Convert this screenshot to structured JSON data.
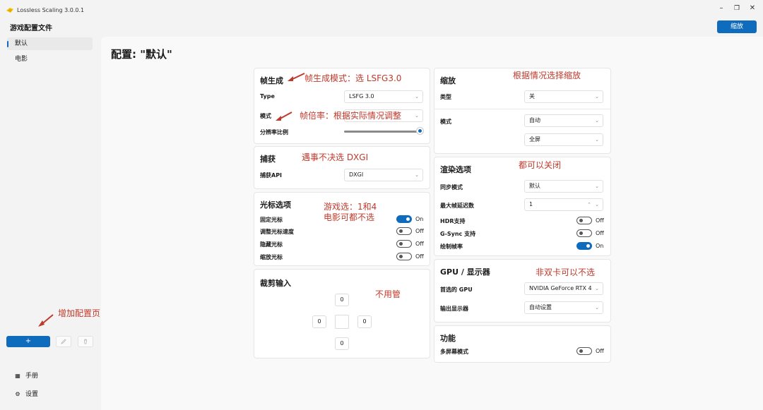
{
  "window": {
    "title": "Lossless Scaling 3.0.0.1",
    "minimize_icon": "minimize-icon",
    "restore_icon": "restore-icon",
    "close_icon": "close-icon"
  },
  "header": {
    "heading": "游戏配置文件",
    "apply_button": "缩放"
  },
  "sidebar": {
    "profiles": [
      {
        "label": "默认",
        "active": true
      },
      {
        "label": "电影",
        "active": false
      }
    ],
    "add_button": "+",
    "bottom_nav": [
      {
        "label": "手册",
        "icon": "book-icon"
      },
      {
        "label": "设置",
        "icon": "gear-icon"
      }
    ]
  },
  "main": {
    "title": "配置: \"默认\"",
    "frame_gen": {
      "title": "帧生成",
      "type_label": "Type",
      "type_value": "LSFG 3.0",
      "mode_label": "模式",
      "mode_value": "",
      "resolution_label": "分辨率比例",
      "resolution_fraction": 1.0
    },
    "capture": {
      "title": "捕获",
      "api_label": "捕获API",
      "api_value": "DXGI"
    },
    "cursor": {
      "title": "光标选项",
      "rows": [
        {
          "label": "固定光标",
          "state": "On",
          "on": true
        },
        {
          "label": "调整光标速度",
          "state": "Off",
          "on": false
        },
        {
          "label": "隐藏光标",
          "state": "Off",
          "on": false
        },
        {
          "label": "缩放光标",
          "state": "Off",
          "on": false
        }
      ]
    },
    "crop": {
      "title": "裁剪输入",
      "top": "0",
      "left": "0",
      "right": "0",
      "bottom": "0"
    },
    "scaling": {
      "title": "缩放",
      "type_label": "类型",
      "type_value": "关",
      "mode_label": "模式",
      "mode_value": "自动",
      "fit_value": "全屏"
    },
    "rendering": {
      "title": "渲染选项",
      "sync_label": "同步模式",
      "sync_value": "默认",
      "latency_label": "最大帧延迟数",
      "latency_value": "1",
      "rows": [
        {
          "label": "HDR支持",
          "state": "Off",
          "on": false
        },
        {
          "label": "G-Sync 支持",
          "state": "Off",
          "on": false
        },
        {
          "label": "绘制帧率",
          "state": "On",
          "on": true
        }
      ]
    },
    "gpu": {
      "title": "GPU / 显示器",
      "gpu_label": "首选的 GPU",
      "gpu_value": "NVIDIA GeForce RTX 4",
      "display_label": "输出显示器",
      "display_value": "自动设置"
    },
    "features": {
      "title": "功能",
      "multi_label": "多屏幕模式",
      "multi_state": "Off"
    }
  },
  "annotations": {
    "frame_gen_mode": "帧生成模式：选 LSFG3.0",
    "frame_rate": "帧倍率：根据实际情况调整",
    "capture": "遇事不决选 DXGI",
    "cursor_line1": "游戏选：1和4",
    "cursor_line2": "电影可都不选",
    "crop": "不用管",
    "scaling": "根据情况选择缩放",
    "rendering": "都可以关闭",
    "gpu": "非双卡可以不选",
    "add_profile": "增加配置页"
  },
  "colors": {
    "accent": "#0f6cbd",
    "annotation": "#c0392b"
  }
}
